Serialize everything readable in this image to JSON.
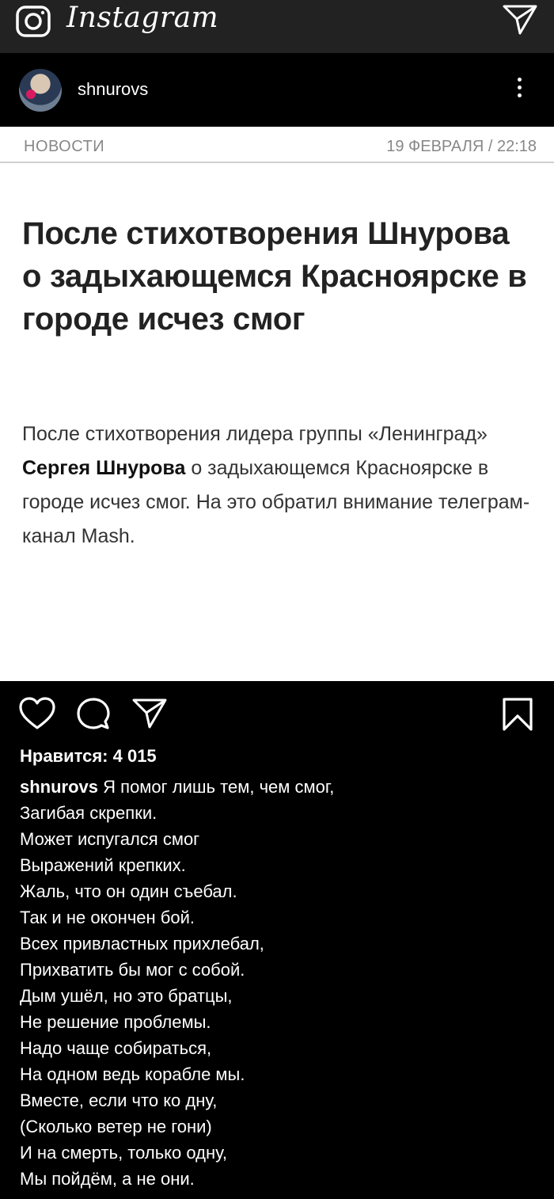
{
  "app": {
    "logo": "Instagram"
  },
  "post": {
    "username": "shnurovs",
    "image": {
      "category": "НОВОСТИ",
      "date": "19 ФЕВРАЛЯ / 22:18",
      "headline": "После стихотворения Шнурова о задыхающемся Красноярске в городе исчез смог",
      "lede_part1": "После стихотворения лидера группы «Ленинград» ",
      "lede_bold": "Сергея Шнурова",
      "lede_part2": " о задыхающемся Красноярске в городе исчез смог. На это обратил внимание телеграм-канал Mash."
    },
    "likes": "Нравится: 4 015",
    "caption_author": "shnurovs",
    "caption_lines": [
      "Я помог лишь тем, чем смог,",
      "Загибая скрепки.",
      "Может испугался смог",
      "Выражений крепких.",
      "Жаль, что он один съебал.",
      "Так и не окончен бой.",
      "Всех привластных прихлебал,",
      "Прихватить бы мог с собой.",
      "Дым ушёл, но это братцы,",
      "Не решение проблемы.",
      "Надо чаще собираться,",
      "На одном ведь корабле мы.",
      "Вместе, если что ко дну,",
      "(Сколько ветер не гони)",
      "И на смерть, только одну,",
      "Мы пойдём, а не они."
    ]
  },
  "icons": {
    "camera": "camera-icon",
    "direct": "paper-plane-icon",
    "more": "more-vertical-icon",
    "like": "heart-icon",
    "comment": "comment-icon",
    "share": "share-icon",
    "save": "bookmark-icon"
  }
}
